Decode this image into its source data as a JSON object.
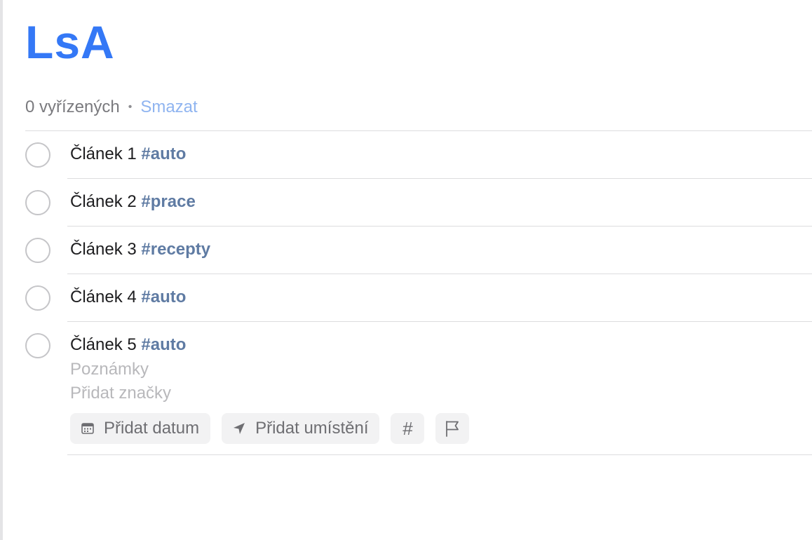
{
  "list": {
    "title": "LsA",
    "completed_count": "0 vyřízených",
    "separator": "•",
    "clear_label": "Smazat"
  },
  "tasks": [
    {
      "title": "Článek 1",
      "tag": "#auto"
    },
    {
      "title": "Článek 2",
      "tag": "#prace"
    },
    {
      "title": "Článek 3",
      "tag": "#recepty"
    },
    {
      "title": "Článek 4",
      "tag": "#auto"
    },
    {
      "title": "Článek 5",
      "tag": "#auto"
    }
  ],
  "editor": {
    "notes_placeholder": "Poznámky",
    "tags_placeholder": "Přidat značky",
    "add_date_label": "Přidat datum",
    "add_location_label": "Přidat umístění",
    "tag_button_glyph": "#",
    "icons": {
      "date": "calendar-icon",
      "location": "location-arrow-icon",
      "flag": "flag-icon"
    }
  },
  "colors": {
    "accent": "#3478f6",
    "tag": "#5f7ba3",
    "clear_link": "#8fb4f0",
    "placeholder": "#b8b8bb"
  }
}
